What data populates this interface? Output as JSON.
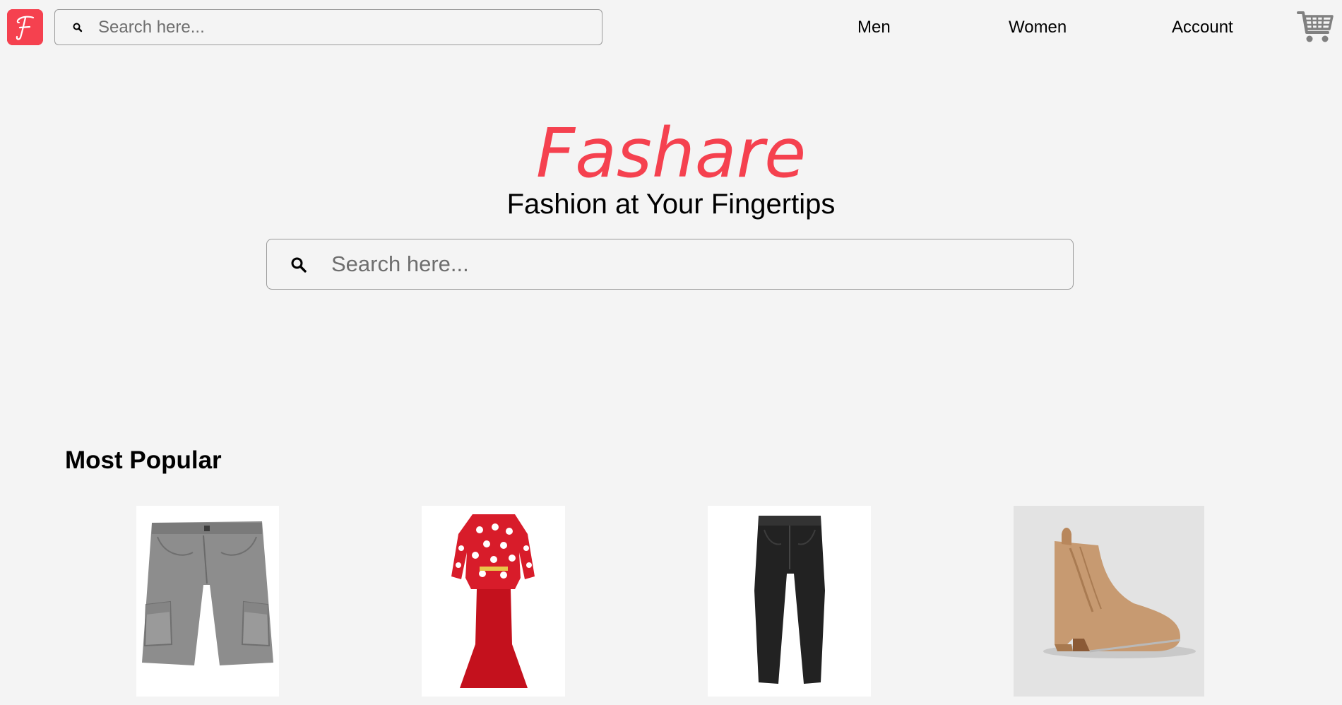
{
  "header": {
    "logo_letter": "F",
    "search": {
      "placeholder": "Search here...",
      "value": ""
    },
    "nav": [
      {
        "label": "Men"
      },
      {
        "label": "Women"
      },
      {
        "label": "Account"
      }
    ],
    "cart_icon": "shopping-cart-icon"
  },
  "hero": {
    "brand": "Fashare",
    "tagline": "Fashion at Your Fingertips",
    "search": {
      "placeholder": "Search here...",
      "value": ""
    }
  },
  "most_popular": {
    "title": "Most Popular",
    "products": [
      {
        "image": "grey-cargo-shorts"
      },
      {
        "image": "red-polka-dot-dress"
      },
      {
        "image": "black-pants"
      },
      {
        "image": "tan-ankle-boot"
      }
    ]
  },
  "colors": {
    "brand": "#f5414f",
    "background": "#f4f4f4",
    "text": "#000000",
    "border": "#9a9a9a"
  }
}
